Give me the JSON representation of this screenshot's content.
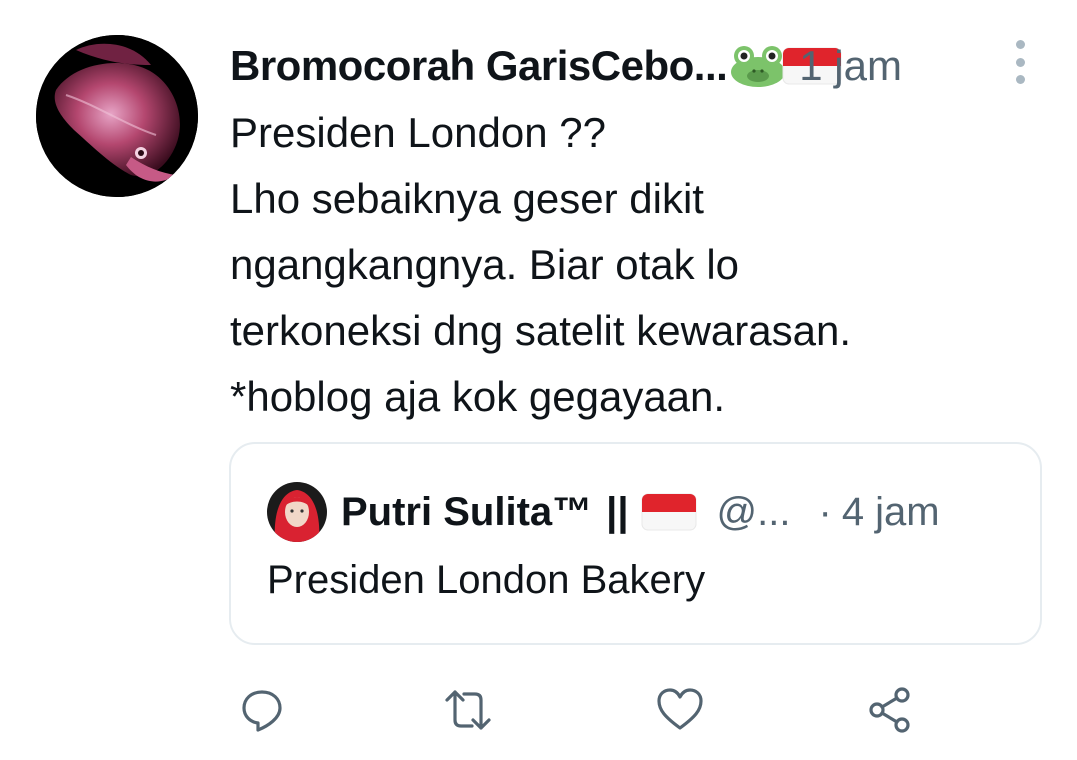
{
  "tweet": {
    "display_name": "Bromocorah GarisCebo...",
    "time": "1 jam",
    "text": "Presiden London ??\nLho sebaiknya geser dikit\nngangkangnya. Biar otak lo\nterkoneksi dng satelit kewarasan.\n*hoblog aja kok gegayaan."
  },
  "quote": {
    "display_name": "Putri Sulita™",
    "separator": "||",
    "handle": "@...",
    "dot": "·",
    "time": "4 jam",
    "text": "Presiden London Bakery"
  },
  "icons": {
    "avatar": "arowana-fish-avatar",
    "emoji_1": "frog-emoji",
    "emoji_2": "indonesia-flag-emoji",
    "more": "more-vertical-icon",
    "reply": "reply-icon",
    "retweet": "retweet-icon",
    "like": "like-icon",
    "share": "share-icon"
  },
  "colors": {
    "text": "#0f1419",
    "secondary": "#536471",
    "border": "#e6ecf0",
    "icon": "#536471",
    "flag_red": "#e0242c"
  }
}
